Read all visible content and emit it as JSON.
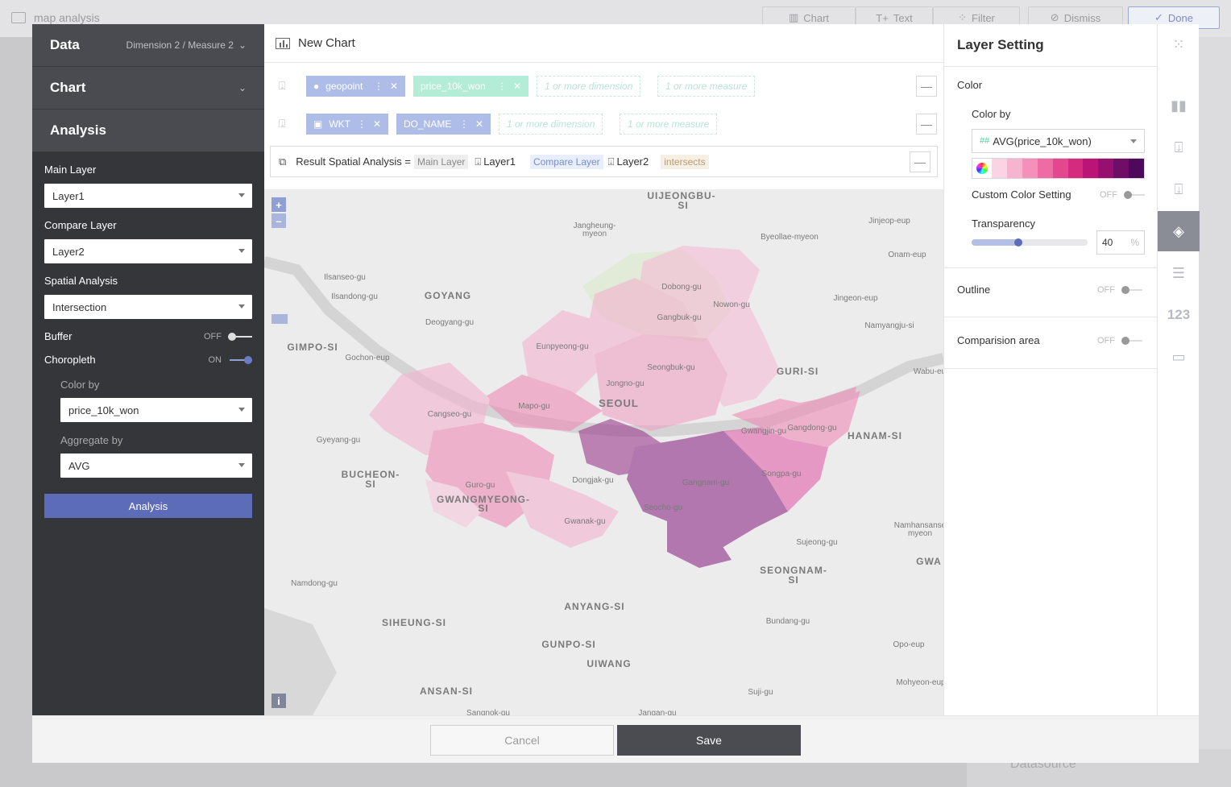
{
  "background": {
    "title": "map analysis",
    "toolbar": {
      "chart": "Chart",
      "text": "Text",
      "filter": "Filter",
      "dismiss": "Dismiss",
      "done": "Done"
    },
    "datasource": "Datasource"
  },
  "left_panel": {
    "data_header": "Data",
    "data_sub": "Dimension 2 / Measure 2",
    "chart_header": "Chart",
    "analysis_header": "Analysis",
    "main_layer_label": "Main Layer",
    "main_layer_value": "Layer1",
    "compare_layer_label": "Compare Layer",
    "compare_layer_value": "Layer2",
    "spatial_label": "Spatial Analysis",
    "spatial_value": "Intersection",
    "buffer_label": "Buffer",
    "buffer_state": "OFF",
    "choropleth_label": "Choropleth",
    "choropleth_state": "ON",
    "color_by_label": "Color by",
    "color_by_value": "price_10k_won",
    "aggregate_label": "Aggregate by",
    "aggregate_value": "AVG",
    "analysis_button": "Analysis"
  },
  "center": {
    "title": "New Chart",
    "row1": {
      "pill1": "geopoint",
      "pill2": "price_10k_won",
      "dim": "1 or more dimension",
      "meas": "1 or more measure"
    },
    "row2": {
      "pill1": "WKT",
      "pill2": "DO_NAME",
      "dim": "1 or more dimension",
      "meas": "1 or more measure"
    },
    "result": {
      "label": "Result Spatial Analysis =",
      "main_tag": "Main Layer",
      "layer1": "Layer1",
      "compare_tag": "Compare Layer",
      "layer2": "Layer2",
      "op": "intersects"
    },
    "zoom_in": "+",
    "zoom_out": "–",
    "info": "i"
  },
  "map_labels": [
    {
      "t": "UIJEONGBU-",
      "c": "city"
    },
    {
      "t": "SI",
      "c": "city"
    },
    {
      "t": "Jangheung-",
      "c": "dist"
    },
    {
      "t": "myeon",
      "c": "dist"
    },
    {
      "t": "Jinjeop-eup",
      "c": "dist"
    },
    {
      "t": "Byeollae-myeon",
      "c": "dist"
    },
    {
      "t": "Onam-eup",
      "c": "dist"
    },
    {
      "t": "Ilsanseo-gu",
      "c": "dist"
    },
    {
      "t": "Ilsandong-gu",
      "c": "dist"
    },
    {
      "t": "GOYANG",
      "c": "city"
    },
    {
      "t": "Dobong-gu",
      "c": "dist"
    },
    {
      "t": "Nowon-gu",
      "c": "dist"
    },
    {
      "t": "Jingeon-eup",
      "c": "dist"
    },
    {
      "t": "Gangbuk-gu",
      "c": "dist"
    },
    {
      "t": "Deogyang-gu",
      "c": "dist"
    },
    {
      "t": "Namyangju-si",
      "c": "dist"
    },
    {
      "t": "GIMPO-SI",
      "c": "city"
    },
    {
      "t": "Eunpyeong-gu",
      "c": "dist"
    },
    {
      "t": "Gochon-eup",
      "c": "dist"
    },
    {
      "t": "Seongbuk-gu",
      "c": "dist"
    },
    {
      "t": "GURI-SI",
      "c": "city"
    },
    {
      "t": "Wabu-eu",
      "c": "dist"
    },
    {
      "t": "Jongno-gu",
      "c": "dist"
    },
    {
      "t": "Mapo-gu",
      "c": "dist"
    },
    {
      "t": "SEOUL",
      "c": "city"
    },
    {
      "t": "Cangseo-gu",
      "c": "dist"
    },
    {
      "t": "Gwangjin-gu",
      "c": "dist"
    },
    {
      "t": "Gangdong-gu",
      "c": "dist"
    },
    {
      "t": "Gyeyang-gu",
      "c": "dist"
    },
    {
      "t": "HANAM-SI",
      "c": "city"
    },
    {
      "t": "Songpa-gu",
      "c": "dist"
    },
    {
      "t": "BUCHEON-",
      "c": "city"
    },
    {
      "t": "SI",
      "c": "city"
    },
    {
      "t": "Dongjak-gu",
      "c": "dist"
    },
    {
      "t": "Guro-gu",
      "c": "dist"
    },
    {
      "t": "Gangnam-gu",
      "c": "dist"
    },
    {
      "t": "GWANGMYEONG-",
      "c": "city"
    },
    {
      "t": "SI",
      "c": "city"
    },
    {
      "t": "Seocho-gu",
      "c": "dist"
    },
    {
      "t": "Gwanak-gu",
      "c": "dist"
    },
    {
      "t": "Namhansanse",
      "c": "dist"
    },
    {
      "t": "myeon",
      "c": "dist"
    },
    {
      "t": "Sujeong-gu",
      "c": "dist"
    },
    {
      "t": "GWA",
      "c": "city"
    },
    {
      "t": "Namdong-gu",
      "c": "dist"
    },
    {
      "t": "SEONGNAM-",
      "c": "city"
    },
    {
      "t": "SI",
      "c": "city"
    },
    {
      "t": "ANYANG-SI",
      "c": "city"
    },
    {
      "t": "Bundang-gu",
      "c": "dist"
    },
    {
      "t": "SIHEUNG-SI",
      "c": "city"
    },
    {
      "t": "GUNPO-SI",
      "c": "city"
    },
    {
      "t": "Opo-eup",
      "c": "dist"
    },
    {
      "t": "UIWANG",
      "c": "city"
    },
    {
      "t": "Mohyeon-eup",
      "c": "dist"
    },
    {
      "t": "ANSAN-SI",
      "c": "city"
    },
    {
      "t": "Suji-gu",
      "c": "dist"
    },
    {
      "t": "Sangnok-gu",
      "c": "dist"
    },
    {
      "t": "Jangan-gu",
      "c": "dist"
    }
  ],
  "right_panel": {
    "title": "Layer Setting",
    "color_section": "Color",
    "color_by_label": "Color by",
    "color_by_prefix": "##",
    "color_by_value": "AVG(price_10k_won)",
    "palette": [
      "#fbd3e3",
      "#f7b4cf",
      "#f490b9",
      "#ee6ca3",
      "#e5478f",
      "#d52b7e",
      "#bb1477",
      "#961070",
      "#6f0d67",
      "#4d0a5b"
    ],
    "custom_color_label": "Custom Color Setting",
    "custom_color_state": "OFF",
    "transparency_label": "Transparency",
    "transparency_value": "40",
    "transparency_unit": "%",
    "outline_label": "Outline",
    "outline_state": "OFF",
    "comparison_label": "Comparision area",
    "comparison_state": "OFF"
  },
  "right_icons": {
    "numeric_label": "123"
  },
  "footer": {
    "cancel": "Cancel",
    "save": "Save"
  }
}
